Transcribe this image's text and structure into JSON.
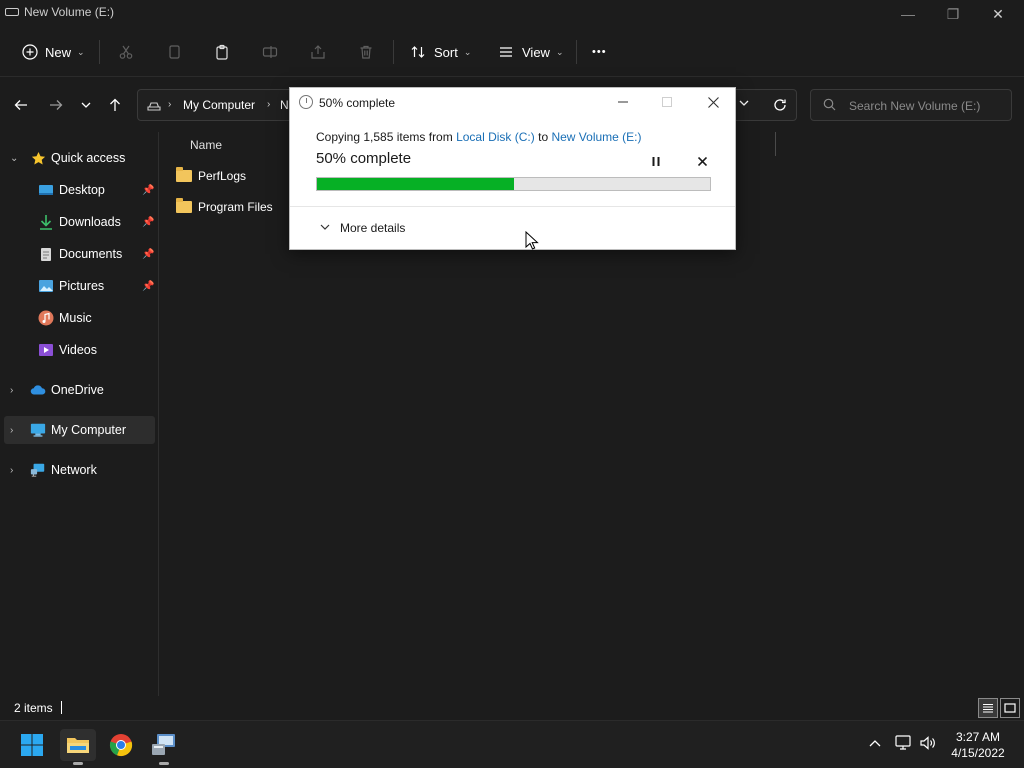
{
  "window": {
    "title": "New Volume (E:)",
    "controls": {
      "minimize": "—",
      "maximize": "❐",
      "close": "✕"
    }
  },
  "commandbar": {
    "new_label": "New",
    "sort_label": "Sort",
    "view_label": "View",
    "more_label": "•••"
  },
  "address": {
    "crumbs": [
      "My Computer",
      "N"
    ],
    "search_placeholder": "Search New Volume (E:)"
  },
  "sidebar": {
    "quick_access": "Quick access",
    "items": [
      {
        "label": "Desktop"
      },
      {
        "label": "Downloads"
      },
      {
        "label": "Documents"
      },
      {
        "label": "Pictures"
      },
      {
        "label": "Music"
      },
      {
        "label": "Videos"
      }
    ],
    "onedrive": "OneDrive",
    "my_computer": "My Computer",
    "network": "Network"
  },
  "content": {
    "column_name": "Name",
    "files": [
      {
        "name": "PerfLogs"
      },
      {
        "name": "Program Files"
      }
    ]
  },
  "statusbar": {
    "item_count": "2 items"
  },
  "taskbar": {
    "time": "3:27 AM",
    "date": "4/15/2022"
  },
  "dialog": {
    "title": "50% complete",
    "copy_prefix": "Copying 1,585 items from",
    "source": "Local Disk (C:)",
    "to_word": "to",
    "destination": "New Volume (E:)",
    "percent_text": "50% complete",
    "progress_fraction": 0.5,
    "more_details": "More details"
  },
  "colors": {
    "progress_fill": "#06b025",
    "link": "#1a6fb6",
    "folder": "#f2c55c"
  }
}
